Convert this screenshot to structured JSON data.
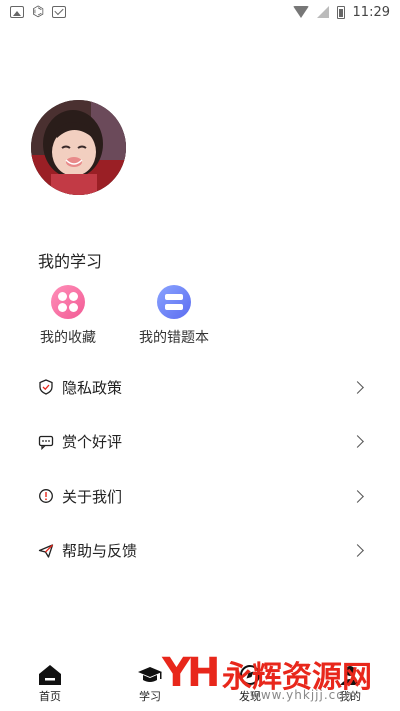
{
  "status_bar": {
    "time": "11:29",
    "left_icons": [
      "photo-icon",
      "bug-icon",
      "mail-icon"
    ],
    "right_icons": [
      "wifi-icon",
      "signal-icon",
      "battery-icon"
    ]
  },
  "profile": {
    "avatar": "avatar"
  },
  "study": {
    "title": "我的学习",
    "links": [
      {
        "label": "我的收藏",
        "icon": "favorites-icon",
        "color": "#f25b95"
      },
      {
        "label": "我的错题本",
        "icon": "mistake-book-icon",
        "color": "#5b6cf0"
      }
    ]
  },
  "menu": {
    "items": [
      {
        "label": "隐私政策",
        "icon": "shield-icon"
      },
      {
        "label": "赏个好评",
        "icon": "comment-icon"
      },
      {
        "label": "关于我们",
        "icon": "info-icon"
      },
      {
        "label": "帮助与反馈",
        "icon": "send-icon"
      }
    ]
  },
  "bottom_nav": {
    "items": [
      {
        "label": "首页",
        "icon": "home-icon"
      },
      {
        "label": "学习",
        "icon": "graduation-cap-icon"
      },
      {
        "label": "发现",
        "icon": "discover-icon"
      },
      {
        "label": "我的",
        "icon": "profile-icon"
      }
    ]
  },
  "watermark": {
    "logo": "YH",
    "name": "永辉资源网",
    "url": "www.yhkjjj.com"
  },
  "colors": {
    "accent_red": "#e8271b",
    "pink": "#f25b95",
    "blue": "#5b6cf0"
  }
}
